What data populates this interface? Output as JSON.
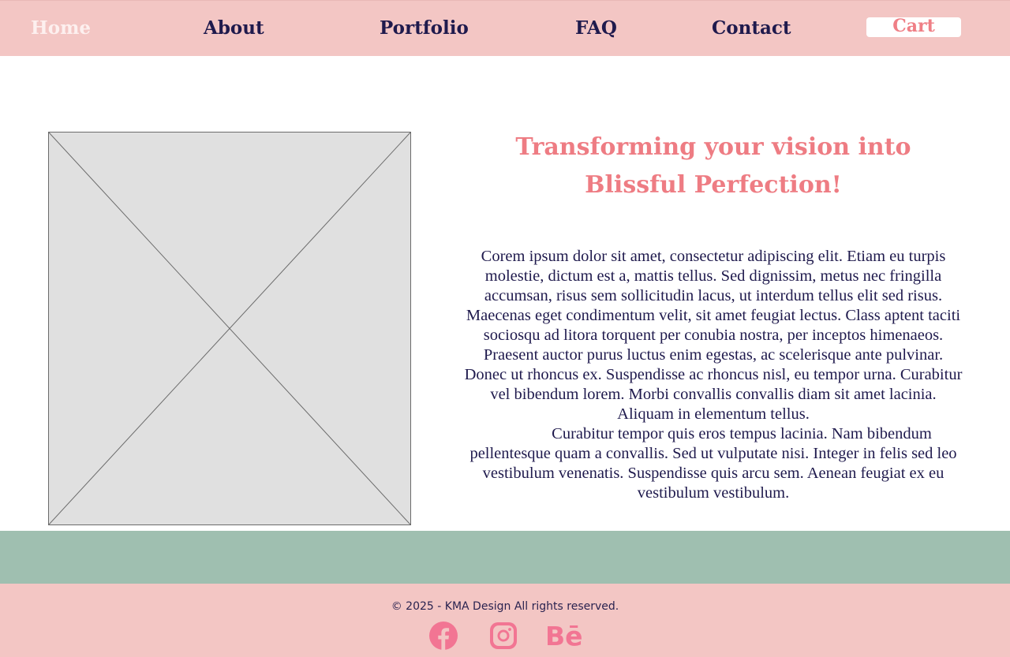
{
  "nav": {
    "items": [
      {
        "label": "Home",
        "active": true
      },
      {
        "label": "About"
      },
      {
        "label": "Portfolio"
      },
      {
        "label": "FAQ"
      },
      {
        "label": "Contact"
      }
    ],
    "cart_label": "Cart"
  },
  "hero": {
    "image": "image-placeholder-icon",
    "title": "Transforming your vision into Blissful Perfection!",
    "paragraphs": [
      "Corem ipsum dolor sit amet, consectetur adipiscing elit. Etiam eu turpis molestie, dictum est a, mattis tellus. Sed dignissim, metus nec fringilla accumsan, risus sem sollicitudin lacus, ut interdum tellus elit sed risus. Maecenas eget condimentum velit, sit amet feugiat lectus. Class aptent taciti sociosqu ad litora torquent per conubia nostra, per inceptos himenaeos. Praesent auctor purus luctus enim egestas, ac scelerisque ante pulvinar. Donec ut rhoncus ex. Suspendisse ac rhoncus nisl, eu tempor urna. Curabitur vel bibendum lorem. Morbi convallis convallis diam sit amet lacinia. Aliquam in elementum tellus.",
      "Curabitur tempor quis eros tempus lacinia. Nam bibendum pellentesque quam a convallis. Sed ut vulputate nisi. Integer in felis sed leo vestibulum venenatis. Suspendisse quis arcu sem. Aenean feugiat ex eu vestibulum vestibulum."
    ]
  },
  "footer": {
    "copyright": "© 2025 - KMA Design All rights reserved.",
    "social": [
      {
        "icon": "facebook-icon"
      },
      {
        "icon": "instagram-icon"
      },
      {
        "icon": "behance-icon",
        "text": "Bē"
      }
    ]
  },
  "colors": {
    "nav_bg": "#f3c6c4",
    "accent_pink": "#ee7c83",
    "navy_text": "#1f1a4d",
    "sage_band": "#9fbfb0",
    "social_pink": "#f27593"
  }
}
